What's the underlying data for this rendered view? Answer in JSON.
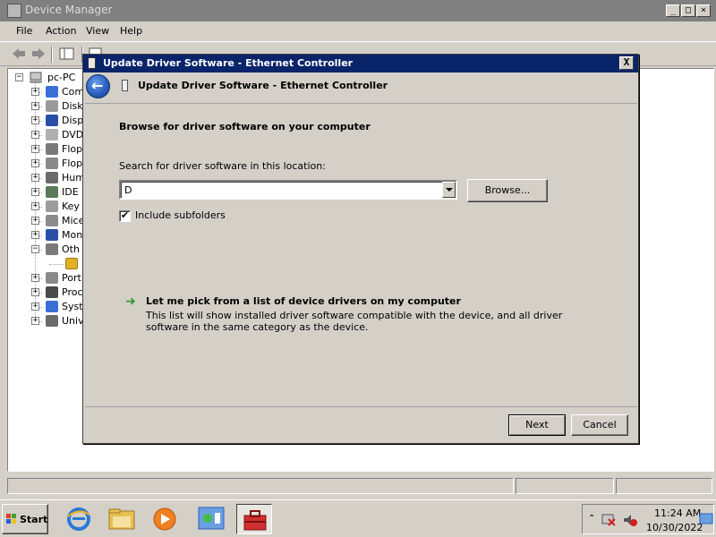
{
  "device_manager": {
    "title": "Device Manager",
    "menu": [
      "File",
      "Action",
      "View",
      "Help"
    ],
    "tree": {
      "root": "pc-PC",
      "items": [
        {
          "label": "Com",
          "expander": "+",
          "icon": "computer-icon",
          "color": "#3a6fd8"
        },
        {
          "label": "Disk",
          "expander": "+",
          "icon": "disk-drive-icon",
          "color": "#9a9a9a"
        },
        {
          "label": "Disp",
          "expander": "+",
          "icon": "display-adapter-icon",
          "color": "#2a4fa8"
        },
        {
          "label": "DVD",
          "expander": "+",
          "icon": "dvd-drive-icon",
          "color": "#b0b0b0"
        },
        {
          "label": "Flop",
          "expander": "+",
          "icon": "floppy-controller-icon",
          "color": "#7a7a7a"
        },
        {
          "label": "Flop",
          "expander": "+",
          "icon": "floppy-drive-icon",
          "color": "#8a8a8a"
        },
        {
          "label": "Hum",
          "expander": "+",
          "icon": "human-interface-icon",
          "color": "#6a6a6a"
        },
        {
          "label": "IDE",
          "expander": "+",
          "icon": "ide-controller-icon",
          "color": "#5a7a5a"
        },
        {
          "label": "Key",
          "expander": "+",
          "icon": "keyboard-icon",
          "color": "#9c9c9c"
        },
        {
          "label": "Mice",
          "expander": "+",
          "icon": "mouse-icon",
          "color": "#8c8c8c"
        },
        {
          "label": "Mon",
          "expander": "+",
          "icon": "monitor-icon",
          "color": "#2a4fa8"
        },
        {
          "label": "Oth",
          "expander": "−",
          "icon": "other-devices-icon",
          "color": "#7a7a7a"
        },
        {
          "label": "",
          "expander": "",
          "icon": "warning-device-icon",
          "color": "#e0b020"
        },
        {
          "label": "Port",
          "expander": "+",
          "icon": "port-icon",
          "color": "#8a8a8a"
        },
        {
          "label": "Proc",
          "expander": "+",
          "icon": "processor-icon",
          "color": "#4a4a4a"
        },
        {
          "label": "Syst",
          "expander": "+",
          "icon": "system-devices-icon",
          "color": "#3a6fd8"
        },
        {
          "label": "Univ",
          "expander": "+",
          "icon": "usb-controller-icon",
          "color": "#6a6a6a"
        }
      ]
    }
  },
  "dialog": {
    "title": "Update Driver Software - Ethernet Controller",
    "header_title": "Update Driver Software - Ethernet Controller",
    "close_label": "X",
    "back_label": "←",
    "heading": "Browse for driver software on your computer",
    "search_label": "Search for driver software in this location:",
    "path_value": "D",
    "browse_label": "Browse...",
    "include_subfolders_label": "Include subfolders",
    "include_subfolders_checked": "✔",
    "pick_arrow": "➜",
    "pick_title": "Let me pick from a list of device drivers on my computer",
    "pick_description": "This list will show installed driver software compatible with the device, and all driver software in the same category as the device.",
    "next_label": "Next",
    "cancel_label": "Cancel"
  },
  "taskbar": {
    "start_label": "Start",
    "apps": [
      {
        "name": "internet-explorer-icon"
      },
      {
        "name": "file-explorer-icon"
      },
      {
        "name": "media-player-icon"
      },
      {
        "name": "control-panel-icon"
      },
      {
        "name": "toolbox-icon",
        "active": true
      }
    ],
    "clock_time": "11:24 AM",
    "clock_date": "10/30/2022"
  },
  "colors": {
    "dialog_title_bg": "#0a246a",
    "window_bg": "#d4d0c8",
    "link_arrow": "#2d9a2d"
  }
}
